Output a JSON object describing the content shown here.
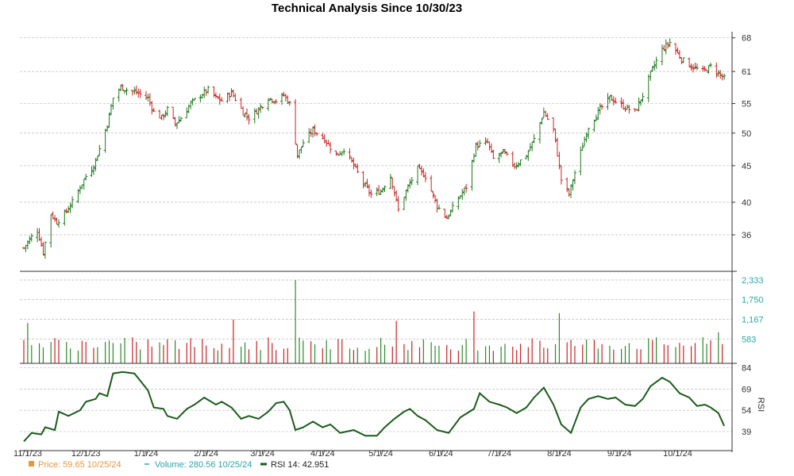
{
  "chart_data": {
    "type": "ohlc-bar",
    "title": "Technical Analysis Since 10/30/23",
    "x_ticks": [
      "11/1/23",
      "12/1/23",
      "1/1/24",
      "2/1/24",
      "3/1/24",
      "4/1/24",
      "5/1/24",
      "6/1/24",
      "7/1/24",
      "8/1/24",
      "9/1/24",
      "10/1/24"
    ],
    "price_panel": {
      "y_ticks": [
        36,
        40,
        45,
        50,
        55,
        61,
        68
      ],
      "ylim": [
        32,
        69
      ],
      "up_color": "#1a7a1a",
      "down_color": "#cc2222",
      "close_series": [
        [
          "2023-10-30",
          34.5
        ],
        [
          "2023-11-02",
          35.5
        ],
        [
          "2023-11-06",
          36.5
        ],
        [
          "2023-11-09",
          34.0
        ],
        [
          "2023-11-13",
          38.5
        ],
        [
          "2023-11-16",
          37.5
        ],
        [
          "2023-11-20",
          38.5
        ],
        [
          "2023-11-24",
          40.0
        ],
        [
          "2023-11-28",
          42.0
        ],
        [
          "2023-12-01",
          43.5
        ],
        [
          "2023-12-05",
          45.0
        ],
        [
          "2023-12-08",
          47.5
        ],
        [
          "2023-12-12",
          51.5
        ],
        [
          "2023-12-15",
          56.0
        ],
        [
          "2023-12-19",
          58.0
        ],
        [
          "2023-12-22",
          57.5
        ],
        [
          "2023-12-27",
          57.0
        ],
        [
          "2024-01-02",
          56.0
        ],
        [
          "2024-01-05",
          53.5
        ],
        [
          "2024-01-09",
          52.5
        ],
        [
          "2024-01-12",
          54.0
        ],
        [
          "2024-01-16",
          51.5
        ],
        [
          "2024-01-19",
          52.5
        ],
        [
          "2024-01-24",
          55.0
        ],
        [
          "2024-01-29",
          56.5
        ],
        [
          "2024-02-02",
          57.5
        ],
        [
          "2024-02-06",
          56.0
        ],
        [
          "2024-02-09",
          55.5
        ],
        [
          "2024-02-14",
          57.0
        ],
        [
          "2024-02-20",
          53.5
        ],
        [
          "2024-02-23",
          52.5
        ],
        [
          "2024-02-28",
          54.0
        ],
        [
          "2024-03-04",
          56.0
        ],
        [
          "2024-03-08",
          55.5
        ],
        [
          "2024-03-12",
          56.5
        ],
        [
          "2024-03-15",
          55.0
        ],
        [
          "2024-03-19",
          46.5
        ],
        [
          "2024-03-22",
          48.5
        ],
        [
          "2024-03-27",
          50.5
        ],
        [
          "2024-04-02",
          49.0
        ],
        [
          "2024-04-08",
          46.5
        ],
        [
          "2024-04-12",
          47.5
        ],
        [
          "2024-04-17",
          45.0
        ],
        [
          "2024-04-22",
          42.5
        ],
        [
          "2024-04-26",
          41.0
        ],
        [
          "2024-05-01",
          41.5
        ],
        [
          "2024-05-06",
          43.5
        ],
        [
          "2024-05-10",
          39.0
        ],
        [
          "2024-05-15",
          42.0
        ],
        [
          "2024-05-20",
          44.5
        ],
        [
          "2024-05-24",
          43.5
        ],
        [
          "2024-05-30",
          39.5
        ],
        [
          "2024-06-04",
          38.0
        ],
        [
          "2024-06-10",
          40.5
        ],
        [
          "2024-06-14",
          42.0
        ],
        [
          "2024-06-19",
          48.0
        ],
        [
          "2024-06-25",
          48.5
        ],
        [
          "2024-06-28",
          46.0
        ],
        [
          "2024-07-03",
          47.0
        ],
        [
          "2024-07-09",
          45.0
        ],
        [
          "2024-07-15",
          46.5
        ],
        [
          "2024-07-19",
          49.0
        ],
        [
          "2024-07-24",
          53.5
        ],
        [
          "2024-07-29",
          50.5
        ],
        [
          "2024-08-02",
          43.0
        ],
        [
          "2024-08-06",
          41.0
        ],
        [
          "2024-08-12",
          47.0
        ],
        [
          "2024-08-16",
          51.0
        ],
        [
          "2024-08-22",
          54.0
        ],
        [
          "2024-08-27",
          56.0
        ],
        [
          "2024-09-03",
          54.5
        ],
        [
          "2024-09-09",
          53.5
        ],
        [
          "2024-09-13",
          56.5
        ],
        [
          "2024-09-18",
          61.5
        ],
        [
          "2024-09-23",
          65.5
        ],
        [
          "2024-09-27",
          67.0
        ],
        [
          "2024-10-03",
          63.5
        ],
        [
          "2024-10-08",
          62.0
        ],
        [
          "2024-10-14",
          61.0
        ],
        [
          "2024-10-18",
          62.0
        ],
        [
          "2024-10-25",
          59.65
        ]
      ]
    },
    "volume_panel": {
      "y_ticks": [
        "583",
        "1,167",
        "1,750",
        "2,333"
      ],
      "ylim": [
        0,
        2333
      ],
      "color": "#2aa6a6",
      "spikes": [
        [
          "2023-10-31",
          1250
        ],
        [
          "2023-11-01",
          1060
        ],
        [
          "2023-12-20",
          1350
        ],
        [
          "2024-02-15",
          1160
        ],
        [
          "2024-03-18",
          2333
        ],
        [
          "2024-03-19",
          1300
        ],
        [
          "2024-05-09",
          1120
        ],
        [
          "2024-06-18",
          1400
        ],
        [
          "2024-08-01",
          1350
        ],
        [
          "2024-09-25",
          870
        ],
        [
          "2024-10-22",
          780
        ]
      ],
      "base_range": [
        230,
        640
      ]
    },
    "rsi_panel": {
      "y_ticks": [
        39,
        54,
        69,
        84
      ],
      "ylim": [
        30,
        86
      ],
      "label": "RSI",
      "color": "#1a5c1a",
      "series": [
        [
          "2023-10-30",
          32
        ],
        [
          "2023-11-03",
          38
        ],
        [
          "2023-11-08",
          37
        ],
        [
          "2023-11-10",
          42
        ],
        [
          "2023-11-15",
          40
        ],
        [
          "2023-11-17",
          53
        ],
        [
          "2023-11-22",
          50
        ],
        [
          "2023-11-28",
          54
        ],
        [
          "2023-12-01",
          60
        ],
        [
          "2023-12-06",
          62
        ],
        [
          "2023-12-08",
          66
        ],
        [
          "2023-12-12",
          64
        ],
        [
          "2023-12-15",
          80
        ],
        [
          "2023-12-20",
          81
        ],
        [
          "2023-12-26",
          80
        ],
        [
          "2024-01-02",
          68
        ],
        [
          "2024-01-05",
          56
        ],
        [
          "2024-01-10",
          55
        ],
        [
          "2024-01-12",
          50
        ],
        [
          "2024-01-17",
          48
        ],
        [
          "2024-01-22",
          55
        ],
        [
          "2024-01-26",
          58
        ],
        [
          "2024-01-31",
          63
        ],
        [
          "2024-02-06",
          58
        ],
        [
          "2024-02-09",
          60
        ],
        [
          "2024-02-14",
          56
        ],
        [
          "2024-02-19",
          48
        ],
        [
          "2024-02-23",
          50
        ],
        [
          "2024-02-28",
          48
        ],
        [
          "2024-03-04",
          53
        ],
        [
          "2024-03-08",
          59
        ],
        [
          "2024-03-12",
          60
        ],
        [
          "2024-03-15",
          54
        ],
        [
          "2024-03-18",
          40
        ],
        [
          "2024-03-22",
          42
        ],
        [
          "2024-03-27",
          46
        ],
        [
          "2024-04-01",
          42
        ],
        [
          "2024-04-05",
          44
        ],
        [
          "2024-04-10",
          38
        ],
        [
          "2024-04-17",
          40
        ],
        [
          "2024-04-23",
          36
        ],
        [
          "2024-04-29",
          36
        ],
        [
          "2024-05-03",
          42
        ],
        [
          "2024-05-08",
          48
        ],
        [
          "2024-05-13",
          53
        ],
        [
          "2024-05-16",
          55
        ],
        [
          "2024-05-20",
          50
        ],
        [
          "2024-05-24",
          47
        ],
        [
          "2024-05-30",
          40
        ],
        [
          "2024-06-05",
          38
        ],
        [
          "2024-06-11",
          49
        ],
        [
          "2024-06-18",
          55
        ],
        [
          "2024-06-21",
          66
        ],
        [
          "2024-06-26",
          60
        ],
        [
          "2024-07-01",
          58
        ],
        [
          "2024-07-05",
          56
        ],
        [
          "2024-07-10",
          52
        ],
        [
          "2024-07-15",
          56
        ],
        [
          "2024-07-19",
          63
        ],
        [
          "2024-07-24",
          70
        ],
        [
          "2024-07-29",
          58
        ],
        [
          "2024-08-02",
          44
        ],
        [
          "2024-08-07",
          38
        ],
        [
          "2024-08-12",
          56
        ],
        [
          "2024-08-16",
          62
        ],
        [
          "2024-08-21",
          64
        ],
        [
          "2024-08-26",
          62
        ],
        [
          "2024-08-30",
          63
        ],
        [
          "2024-09-04",
          58
        ],
        [
          "2024-09-09",
          57
        ],
        [
          "2024-09-13",
          62
        ],
        [
          "2024-09-17",
          71
        ],
        [
          "2024-09-23",
          77
        ],
        [
          "2024-09-27",
          74
        ],
        [
          "2024-10-02",
          66
        ],
        [
          "2024-10-07",
          63
        ],
        [
          "2024-10-11",
          57
        ],
        [
          "2024-10-15",
          58
        ],
        [
          "2024-10-18",
          56
        ],
        [
          "2024-10-22",
          52
        ],
        [
          "2024-10-25",
          42.951
        ]
      ]
    },
    "legend": {
      "price_label": "Price: 59.65  10/25/24",
      "price_color": "#e8963a",
      "volume_label": "Volume: 280.56  10/25/24",
      "volume_color": "#2aa6a6",
      "rsi_label": "RSI 14: 42.951",
      "rsi_color": "#1a5c1a"
    }
  }
}
